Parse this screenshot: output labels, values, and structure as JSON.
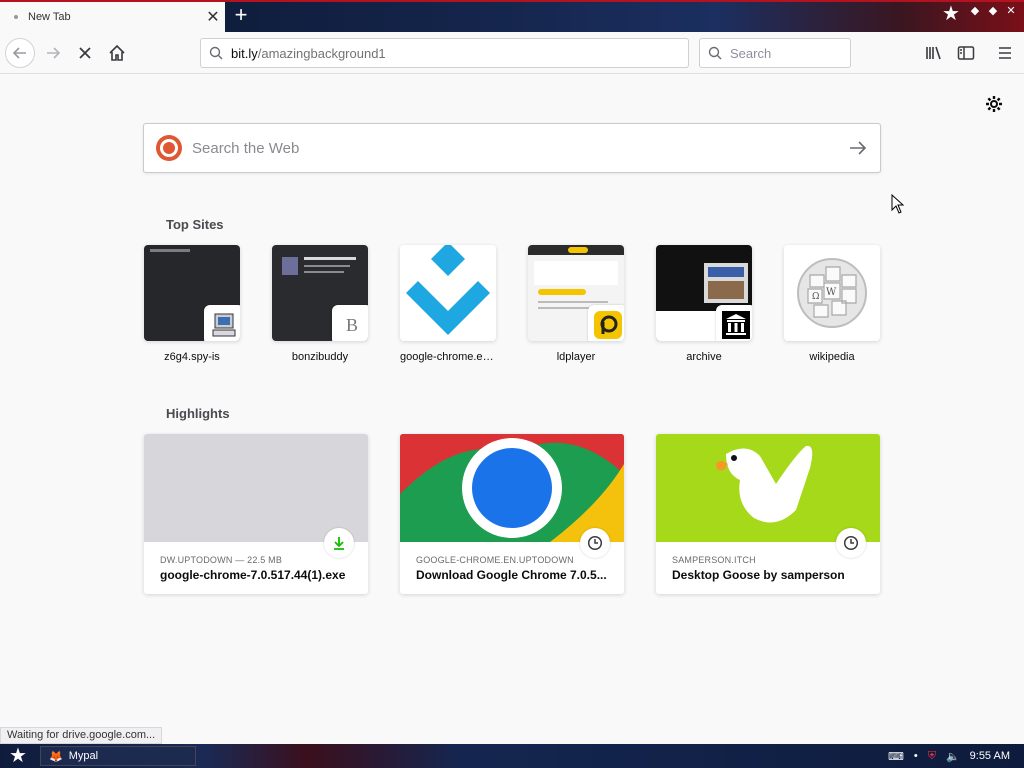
{
  "tab": {
    "title": "New Tab",
    "close_glyph": "✕"
  },
  "toolbar": {
    "url_host": "bit.ly",
    "url_path": "/amazingbackground1",
    "search_placeholder": "Search"
  },
  "newtab": {
    "web_search_placeholder": "Search the Web",
    "top_sites_title": "Top Sites",
    "top_sites": [
      {
        "label": "z6g4.spy-is",
        "icon": "computer-icon"
      },
      {
        "label": "bonzibuddy",
        "icon": "letter-b-icon",
        "badge_text": "B"
      },
      {
        "label": "google-chrome.en...",
        "icon": "uptodown-icon"
      },
      {
        "label": "ldplayer",
        "icon": "ldplayer-icon"
      },
      {
        "label": "archive",
        "icon": "archive-icon"
      },
      {
        "label": "wikipedia",
        "icon": "wikipedia-globe-icon"
      }
    ],
    "highlights_title": "Highlights",
    "highlights": [
      {
        "source": "DW.UPTODOWN — 22.5 MB",
        "title": "google-chrome-7.0.517.44(1).exe",
        "type_icon": "download-icon"
      },
      {
        "source": "GOOGLE-CHROME.EN.UPTODOWN",
        "title": "Download Google Chrome 7.0.5...",
        "type_icon": "clock-icon"
      },
      {
        "source": "SAMPERSON.ITCH",
        "title": "Desktop Goose by samperson",
        "type_icon": "clock-icon"
      }
    ]
  },
  "status_text": "Waiting for drive.google.com...",
  "taskbar": {
    "app_label": "Mypal",
    "time": "9:55 AM"
  },
  "colors": {
    "accent_red": "#c3121e",
    "ddg_orange": "#de5833",
    "uptodown_blue": "#1ea7e1",
    "ldplayer_yellow": "#f5c400",
    "download_green": "#12bc00"
  }
}
